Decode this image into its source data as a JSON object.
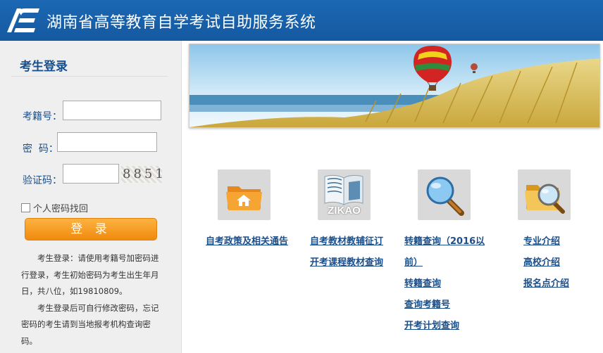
{
  "header": {
    "title": "湖南省高等教育自学考试自助服务系统",
    "logo_icon": "logo-icon"
  },
  "login": {
    "title": "考生登录",
    "exam_id_label": "考籍号：",
    "password_label": "密  码：",
    "captcha_label": "验证码：",
    "captcha_code": "8851",
    "recover_label": "个人密码找回",
    "login_button": "登 录",
    "note1": "考生登录：请使用考籍号加密码进行登录，考生初始密码为考生出生年月日，共八位，如19810809。",
    "note2": "考生登录后可自行修改密码，忘记密码的考生请到当地报考机构查询密码。"
  },
  "columns": [
    {
      "icon": "folder-home-icon",
      "links": [
        "自考政策及相关通告"
      ]
    },
    {
      "icon": "zikao-book-icon",
      "badge": "ZIKAO",
      "links": [
        "自考教材教辅征订",
        "开考课程教材查询"
      ]
    },
    {
      "icon": "magnifier-icon",
      "links": [
        "转籍查询（2016以",
        "前）",
        "转籍查询",
        "查询考籍号",
        "开考计划查询"
      ]
    },
    {
      "icon": "folder-search-icon",
      "links": [
        "专业介绍",
        "高校介绍",
        "报名点介绍"
      ]
    }
  ],
  "colors": {
    "header": "#1c68b3",
    "link": "#1c4f8a",
    "button": "#f39a1f",
    "sidebar": "#efefef"
  }
}
